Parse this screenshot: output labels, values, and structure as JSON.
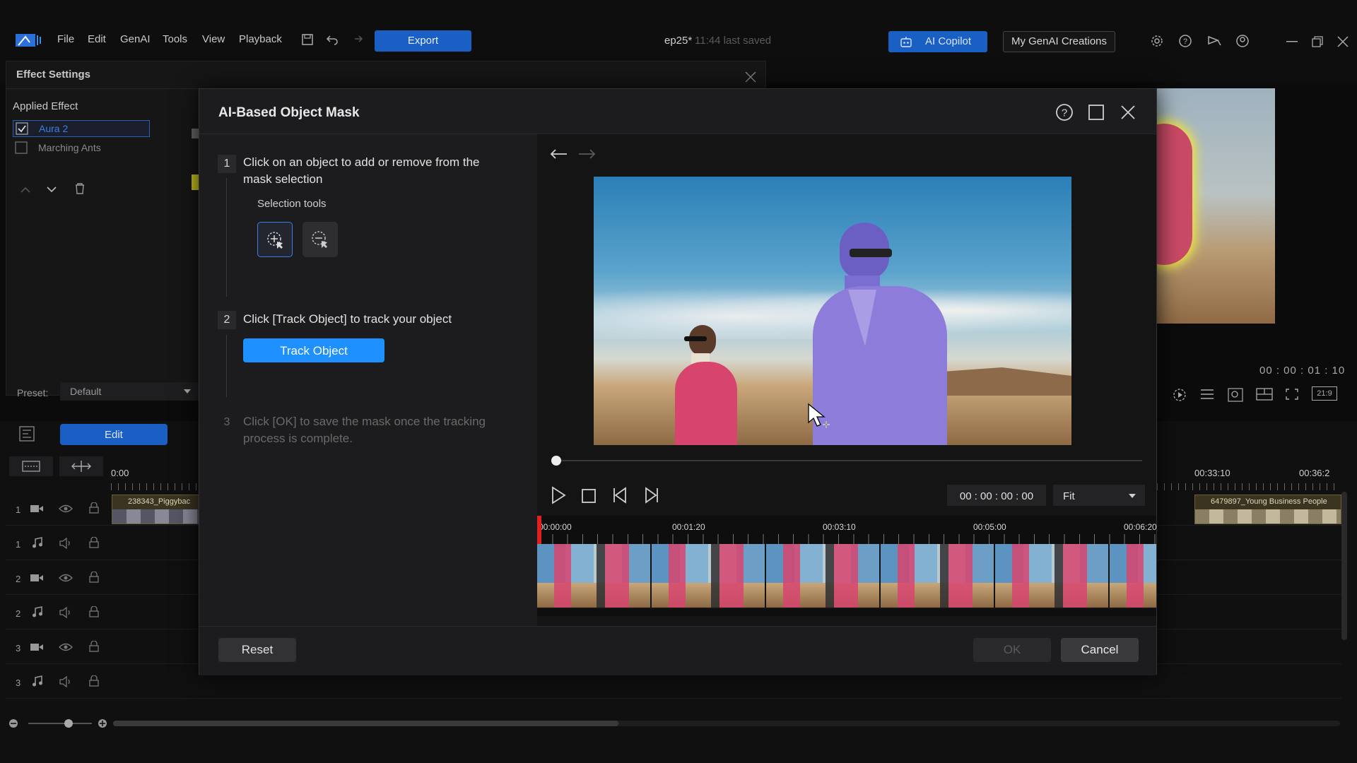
{
  "menubar": {
    "items": [
      "File",
      "Edit",
      "GenAI",
      "Tools",
      "View",
      "Playback"
    ],
    "export_label": "Export",
    "project_name": "ep25*",
    "save_status": "11:44 last saved",
    "ai_copilot_label": "AI Copilot",
    "genai_creations_label": "My GenAI Creations"
  },
  "effect_panel": {
    "title": "Effect Settings",
    "applied_effect_label": "Applied Effect",
    "effects": [
      {
        "name": "Aura 2",
        "checked": true
      },
      {
        "name": "Marching Ants",
        "checked": false
      }
    ],
    "preset_label": "Preset:",
    "preset_value": "Default",
    "edit_label": "Edit"
  },
  "right_preview": {
    "timecode": "00 : 00 : 01 : 10",
    "aspect": "21:9"
  },
  "timeline": {
    "start_label": "0:00",
    "right_labels": [
      "00:33:10",
      "00:36:2"
    ],
    "clip_left": "238343_Piggybac",
    "clip_right": "6479897_Young Business People",
    "tracks": [
      "1",
      "1",
      "2",
      "2",
      "3",
      "3"
    ]
  },
  "dialog": {
    "title": "AI-Based Object Mask",
    "step1_num": "1",
    "step1_text": "Click on an object to add or remove from the mask selection",
    "selection_tools_label": "Selection tools",
    "step2_num": "2",
    "step2_text": "Click [Track Object] to track your object",
    "track_object_label": "Track Object",
    "step3_num": "3",
    "step3_text": "Click [OK] to save the mask once the tracking process is complete.",
    "timecode": "00 : 00 : 00 : 00",
    "zoom_value": "Fit",
    "ruler_labels": [
      "00:00:00",
      "00:01:20",
      "00:03:10",
      "00:05:00",
      "00:06:20"
    ],
    "reset_label": "Reset",
    "ok_label": "OK",
    "cancel_label": "Cancel"
  },
  "colors": {
    "accent": "#1a73e8",
    "bright_accent": "#1e90ff",
    "mask_purple": "#8d7cd9",
    "pink_jacket": "#d7456f"
  }
}
